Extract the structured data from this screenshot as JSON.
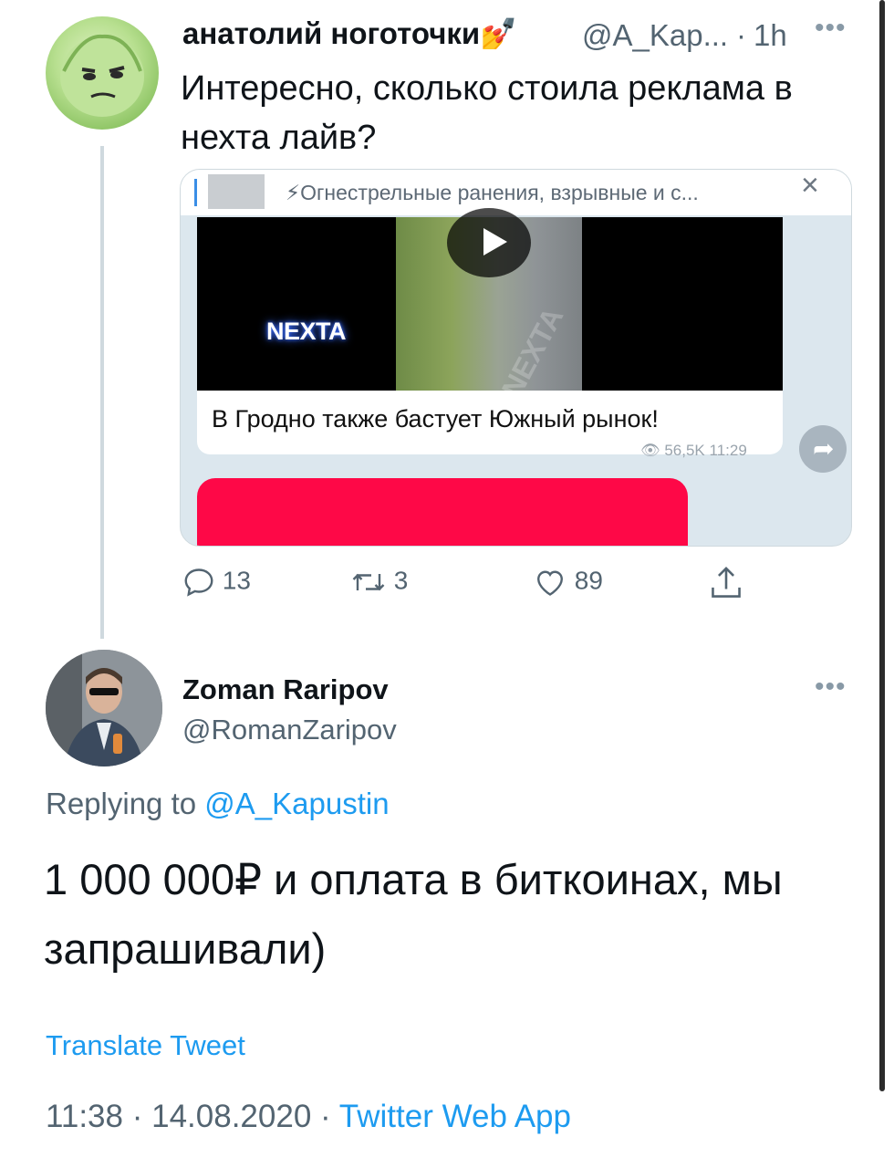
{
  "parent_tweet": {
    "display_name": "анатолий ноготочки💅",
    "handle": "@A_Kap...",
    "dot": "·",
    "time": "1h",
    "more": "•••",
    "text": "Интересно, сколько стоила реклама в нехта лайв?",
    "media": {
      "pinned_text": "⚡Огнестрельные ранения, взрывные и с...",
      "close": "×",
      "logo": "NEXTA",
      "watermark": "NEXTA",
      "message_text": "В Гродно также бастует Южный рынок!",
      "views": "56,5K",
      "message_time": "11:29",
      "forward_icon": "forward-arrow-icon"
    },
    "actions": {
      "replies": "13",
      "retweets": "3",
      "likes": "89"
    }
  },
  "reply_tweet": {
    "display_name": "Zoman Raripov",
    "handle": "@RomanZaripov",
    "more": "•••",
    "replying_prefix": "Replying to",
    "replying_handle": "@A_Kapustin",
    "text": "1 000 000₽ и оплата в биткоинах, мы запрашивали)",
    "translate_label": "Translate Tweet",
    "time": "11:38",
    "sep1": "·",
    "date": "14.08.2020",
    "sep2": "·",
    "source": "Twitter Web App"
  },
  "colors": {
    "link": "#1d9bf0",
    "secondary_text": "#536471",
    "thread_line": "#cfd9de",
    "pink_bubble": "#fe0847"
  }
}
